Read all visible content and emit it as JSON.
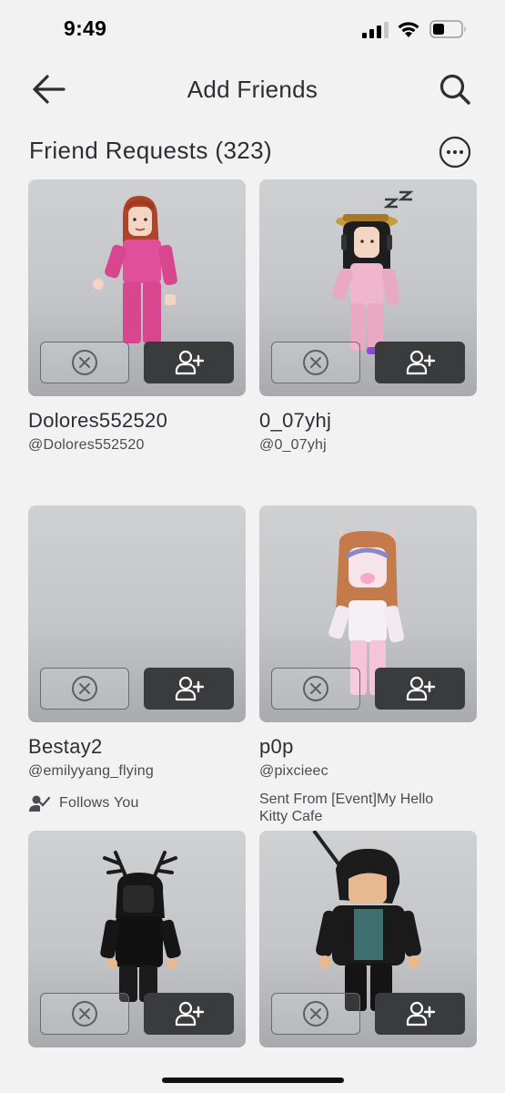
{
  "status_bar": {
    "time": "9:49"
  },
  "nav": {
    "title": "Add Friends"
  },
  "section": {
    "title": "Friend Requests (323)"
  },
  "requests": [
    {
      "display_name": "Dolores552520",
      "username": "@Dolores552520"
    },
    {
      "display_name": "0_07yhj",
      "username": "@0_07yhj"
    },
    {
      "display_name": "Bestay2",
      "username": "@emilyyang_flying",
      "extra": "Follows You"
    },
    {
      "display_name": "p0p",
      "username": "@pixcieec",
      "extra": "Sent From [Event]My Hello Kitty Cafe"
    },
    {
      "display_name": "",
      "username": ""
    },
    {
      "display_name": "",
      "username": ""
    }
  ],
  "colors": {
    "background": "#f2f2f3",
    "accept_button": "#393b3d",
    "text": "#2d2e33"
  }
}
